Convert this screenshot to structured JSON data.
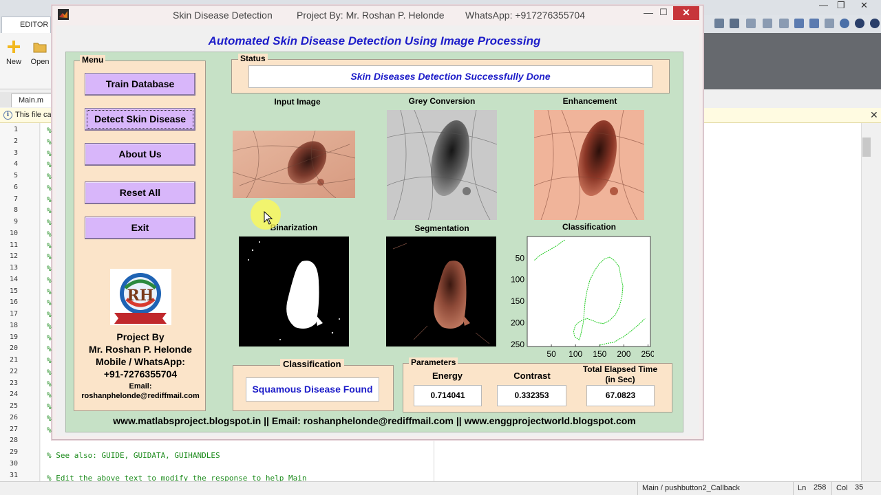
{
  "ide": {
    "editor_tab": "EDITOR",
    "ribbon": [
      {
        "label": "New",
        "icon": "new-file-icon"
      },
      {
        "label": "Open",
        "icon": "open-folder-icon"
      }
    ],
    "file_tab": "Main.m",
    "info_text": "This file ca",
    "line_numbers": [
      "1",
      "2",
      "3",
      "4",
      "5",
      "6",
      "7",
      "8",
      "9",
      "10",
      "11",
      "12",
      "13",
      "14",
      "15",
      "16",
      "17",
      "18",
      "19",
      "20",
      "21",
      "22",
      "23",
      "24",
      "25",
      "26",
      "27",
      "28",
      "29",
      "30",
      "31"
    ],
    "code_line_29": "% See also: GUIDE, GUIDATA, GUIHANDLES",
    "code_line_31": "% Edit the above text to modify the response to help Main",
    "status": {
      "function": "Main / pushbutton2_Callback",
      "ln_label": "Ln",
      "ln_value": "258",
      "col_label": "Col",
      "col_value": "35"
    }
  },
  "window": {
    "app_title": "Skin Disease Detection",
    "project_by": "Project By: Mr. Roshan P. Helonde",
    "whatsapp": "WhatsApp: +917276355704",
    "min_glyph": "—",
    "max_glyph": "☐",
    "close_glyph": "✕"
  },
  "heading": "Automated Skin Disease Detection Using Image Processing",
  "menu": {
    "title": "Menu",
    "buttons": [
      "Train Database",
      "Detect Skin Disease",
      "About Us",
      "Reset All",
      "Exit"
    ],
    "credits": {
      "line1": "Project By",
      "line2": "Mr. Roshan P. Helonde",
      "line3": "Mobile / WhatsApp:",
      "line4": "+91-7276355704",
      "email_label": "Email:",
      "email": "roshanphelonde@rediffmail.com"
    }
  },
  "status": {
    "title": "Status",
    "message": "Skin Diseases Detection Successfully Done"
  },
  "images": {
    "input": "Input Image",
    "grey": "Grey Conversion",
    "enhance": "Enhancement",
    "binary": "Binarization",
    "segment": "Segmentation",
    "classify": "Classification"
  },
  "chart_data": {
    "type": "line",
    "title": "Classification",
    "xlabel": "",
    "ylabel": "",
    "xlim": [
      0,
      255
    ],
    "ylim": [
      0,
      255
    ],
    "y_reversed": true,
    "xticks": [
      50,
      100,
      150,
      200,
      250
    ],
    "yticks": [
      50,
      100,
      150,
      200,
      250
    ],
    "grid": false,
    "series": [
      {
        "values_x": [
          108,
          98,
          96,
          100,
          112,
          124,
          136,
          146,
          158,
          170,
          182,
          190,
          196,
          198,
          194,
          190,
          180,
          170,
          160,
          150,
          140,
          130,
          124,
          120,
          118,
          116,
          112,
          108
        ],
        "values_y": [
          240,
          232,
          220,
          205,
          195,
          190,
          195,
          200,
          202,
          195,
          182,
          165,
          140,
          115,
          95,
          70,
          55,
          48,
          52,
          62,
          78,
          100,
          125,
          150,
          175,
          200,
          222,
          240
        ]
      },
      {
        "values_x": [
          150,
          165,
          180,
          190,
          200,
          214,
          230,
          244
        ],
        "values_y": [
          252,
          248,
          245,
          238,
          232,
          220,
          205,
          190
        ]
      },
      {
        "values_x": [
          15,
          25,
          35,
          48,
          60,
          70,
          78
        ],
        "values_y": [
          55,
          45,
          38,
          30,
          22,
          14,
          8
        ]
      }
    ],
    "color": "#22cc22"
  },
  "classification": {
    "title": "Classification",
    "result": "Squamous Disease Found"
  },
  "parameters": {
    "title": "Parameters",
    "energy_label": "Energy",
    "energy_value": "0.714041",
    "contrast_label": "Contrast",
    "contrast_value": "0.332353",
    "time_label_1": "Total Elapsed Time",
    "time_label_2": "(in Sec)",
    "time_value": "67.0823"
  },
  "footer": "www.matlabsproject.blogspot.in  ||  Email: roshanphelonde@rediffmail.com   ||  www.enggprojectworld.blogspot.com",
  "colors": {
    "heading": "#1d1dc9",
    "panel_green": "#c6e1c6",
    "panel_peach": "#fbe4c9",
    "button_purple": "#d8b6fa",
    "close_red": "#c7353a"
  }
}
